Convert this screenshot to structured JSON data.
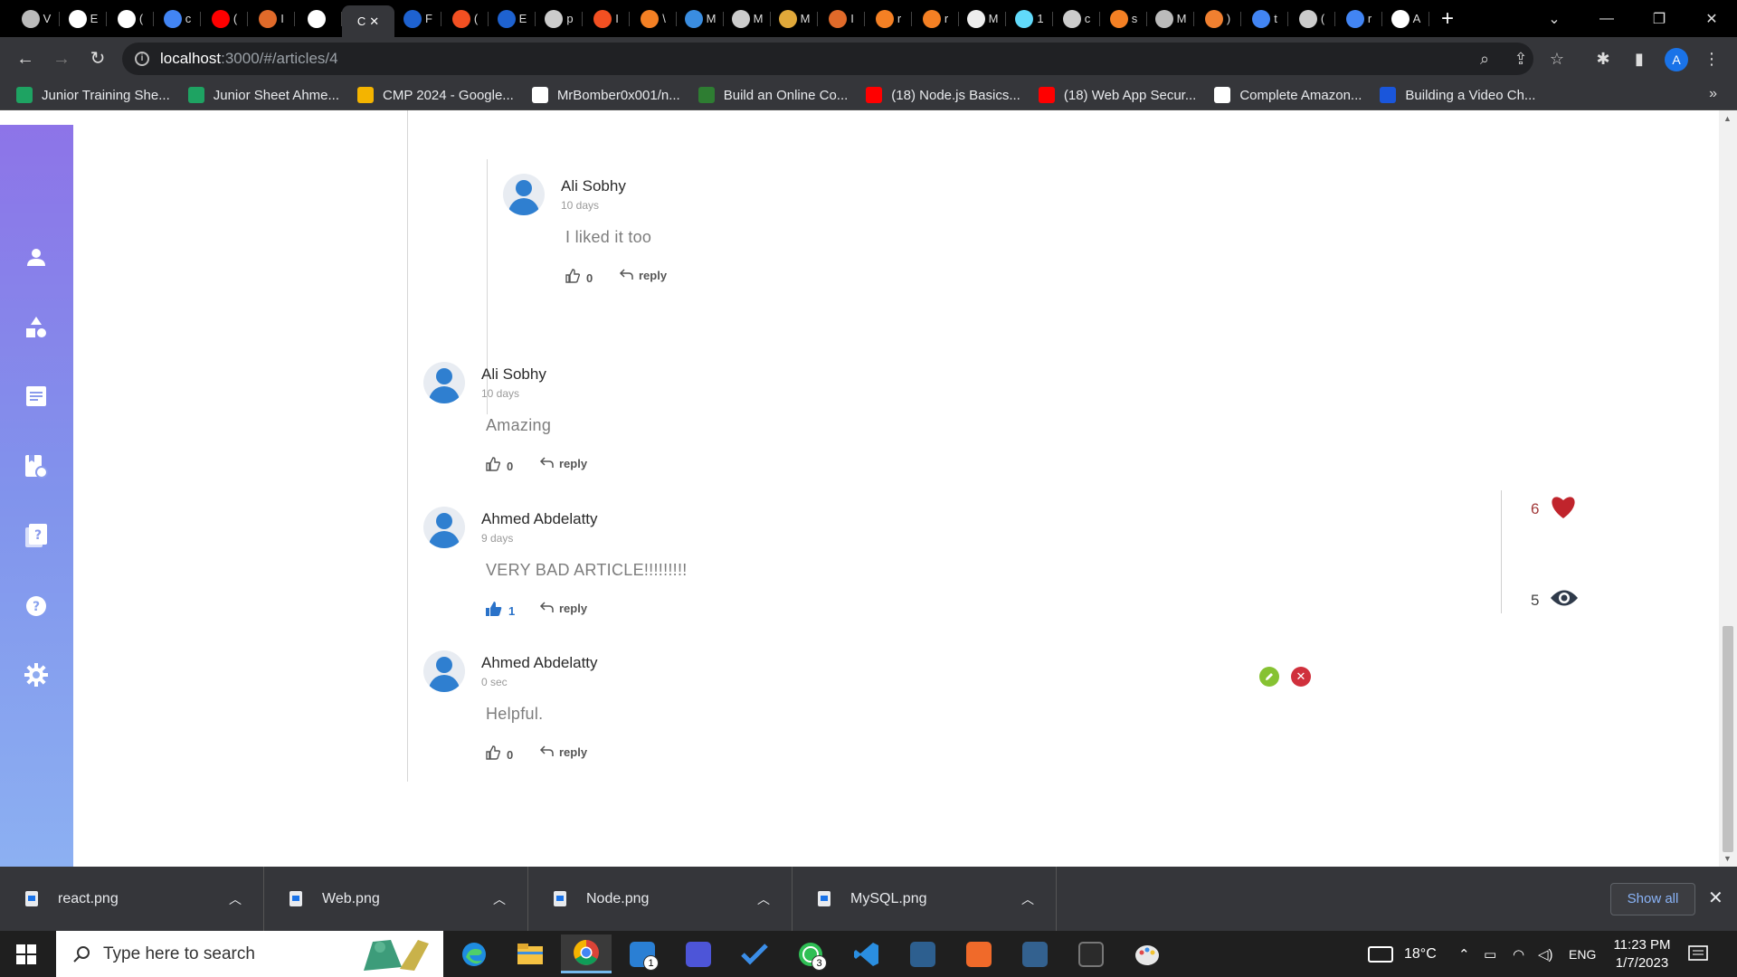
{
  "browser": {
    "active_tab_letter": "C",
    "tab_letters": [
      "V",
      "E",
      "(",
      "c",
      "(",
      "I",
      "",
      "F",
      "(",
      "E",
      "p",
      "I",
      "\\",
      "M",
      "M",
      "M",
      "I",
      "r",
      "r",
      "M",
      "1",
      "c",
      "s",
      "M",
      ")",
      "t",
      "(",
      "r",
      "A"
    ],
    "url_host": "localhost",
    "url_rest": ":3000/#/articles/4",
    "profile_initial": "A",
    "bookmarks": [
      {
        "label": "Junior Training She...",
        "color": "#1ea362"
      },
      {
        "label": "Junior Sheet Ahme...",
        "color": "#1ea362"
      },
      {
        "label": "CMP 2024 - Google...",
        "color": "#f4b400"
      },
      {
        "label": "MrBomber0x001/n...",
        "color": "#ffffff"
      },
      {
        "label": "Build an Online Co...",
        "color": "#2e7d32"
      },
      {
        "label": "(18) Node.js Basics...",
        "color": "#ff0000"
      },
      {
        "label": "(18) Web App Secur...",
        "color": "#ff0000"
      },
      {
        "label": "Complete Amazon...",
        "color": "#ffffff"
      },
      {
        "label": "Building a Video Ch...",
        "color": "#1a56db"
      }
    ],
    "bookmarks_more": "»"
  },
  "page": {
    "top_partial": {
      "like_count": "0",
      "reply_label": "reply"
    },
    "comments": [
      {
        "name": "Ali Sobhy",
        "time": "10 days",
        "text": "I liked it too",
        "likes": "0",
        "reply_label": "reply",
        "liked": false
      },
      {
        "name": "Ali Sobhy",
        "time": "10 days",
        "text": "Amazing",
        "likes": "0",
        "reply_label": "reply",
        "liked": false
      },
      {
        "name": "Ahmed Abdelatty",
        "time": "9 days",
        "text": "VERY BAD ARTICLE!!!!!!!!!",
        "likes": "1",
        "reply_label": "reply",
        "liked": true
      },
      {
        "name": "Ahmed Abdelatty",
        "time": "0 sec",
        "text": "Helpful.",
        "likes": "0",
        "reply_label": "reply",
        "liked": false
      }
    ],
    "stats": {
      "likes": "6",
      "views": "5"
    },
    "sidebar_icons": [
      "user-icon",
      "shapes-icon",
      "document-icon",
      "bookmark-icon",
      "quiz-icon",
      "help-icon",
      "settings-icon"
    ],
    "colors": {
      "sidebar_top": "#8d74e8",
      "sidebar_bottom": "#8cb0f2",
      "avatar": "#2f7fd0",
      "heart": "#c0242c",
      "edit": "#86c232",
      "delete": "#d0303c",
      "liked": "#2a72c9"
    }
  },
  "downloads": {
    "files": [
      "react.png",
      "Web.png",
      "Node.png",
      "MySQL.png"
    ],
    "show_all": "Show all"
  },
  "taskbar": {
    "search_placeholder": "Type here to search",
    "mail_badge": "1",
    "whatsapp_badge": "3",
    "temperature": "18°C",
    "language": "ENG",
    "time": "11:23 PM",
    "date": "1/7/2023"
  }
}
